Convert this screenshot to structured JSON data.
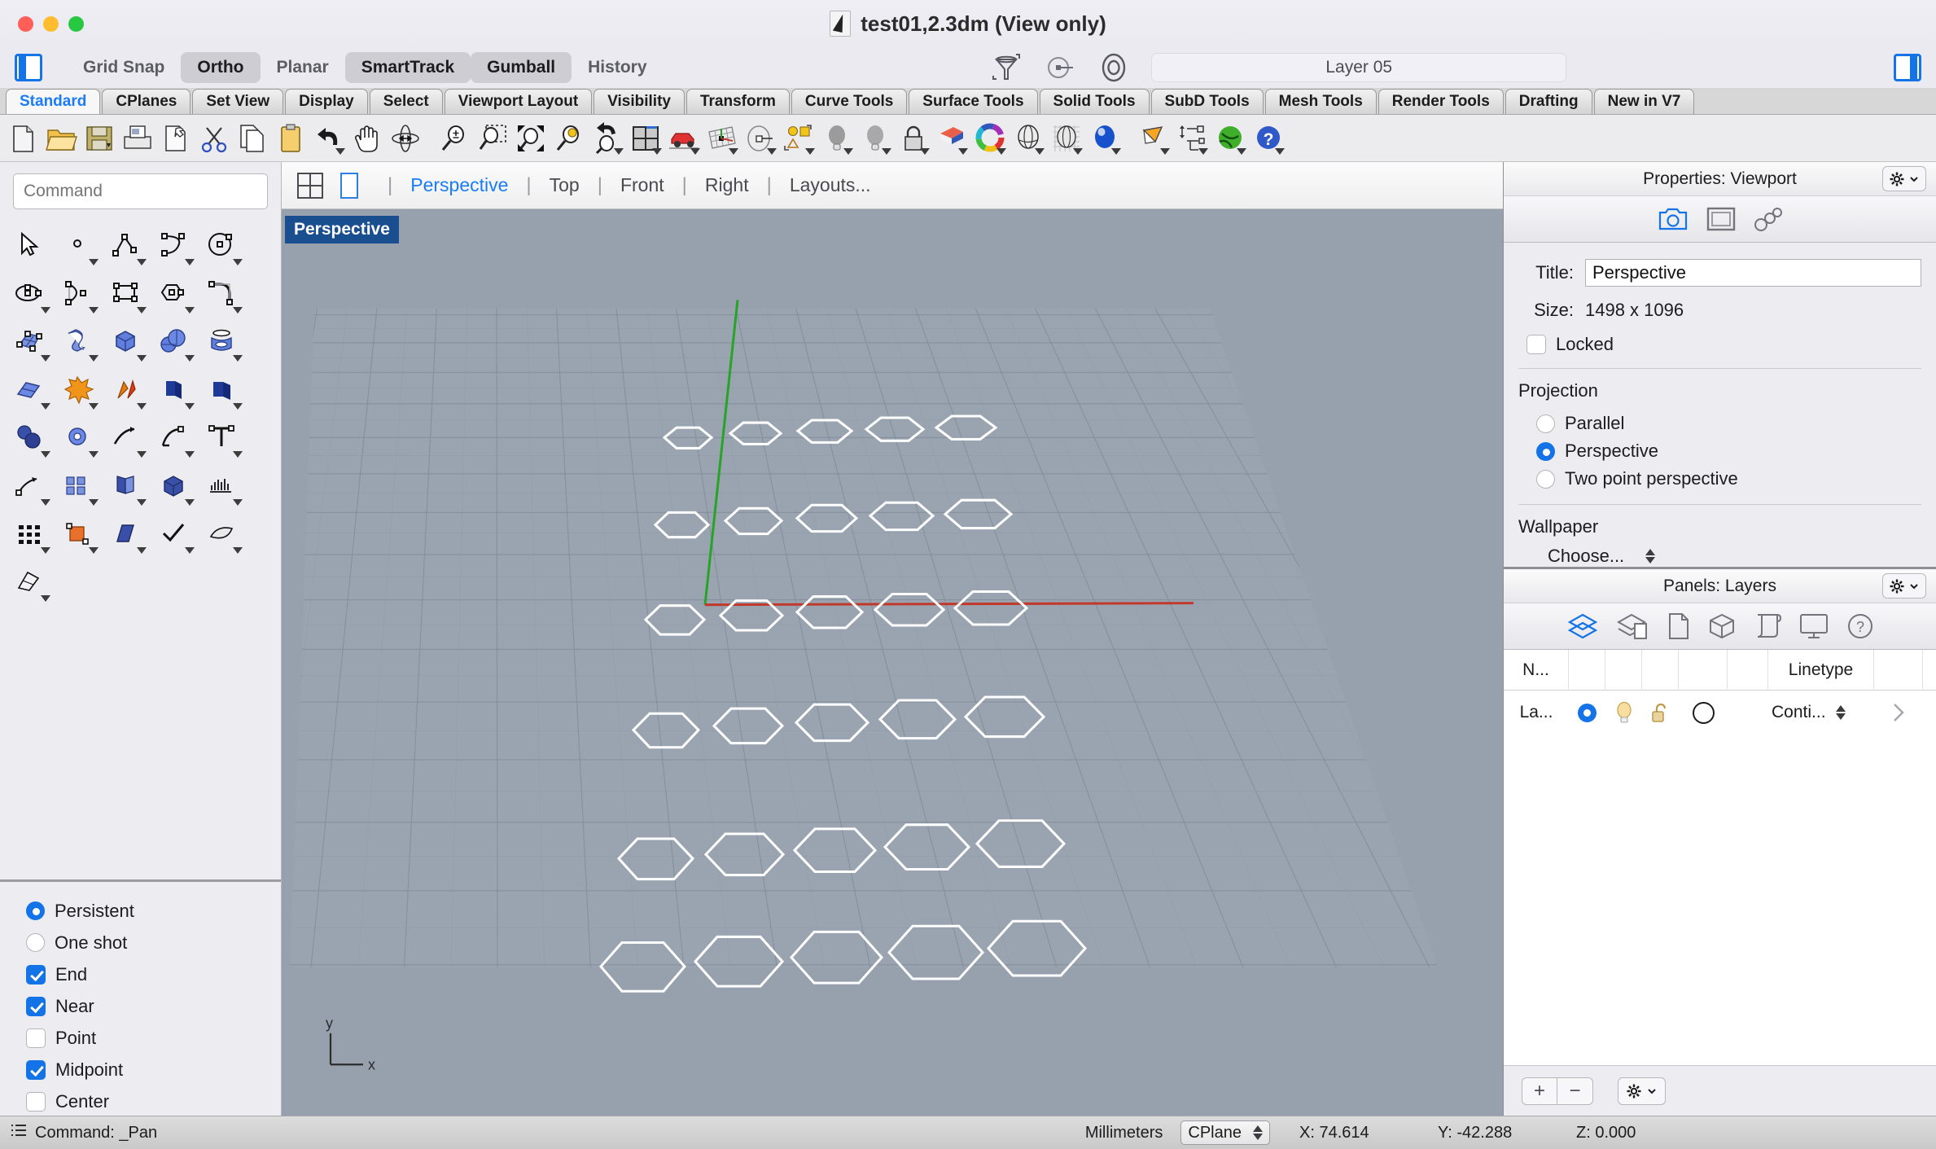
{
  "window": {
    "title": "test01,2.3dm (View only)",
    "doc_icon": "rhino-document-icon"
  },
  "toggles": [
    {
      "label": "Grid Snap",
      "on": false
    },
    {
      "label": "Ortho",
      "on": true
    },
    {
      "label": "Planar",
      "on": false
    },
    {
      "label": "SmartTrack",
      "on": true
    },
    {
      "label": "Gumball",
      "on": true
    },
    {
      "label": "History",
      "on": false
    }
  ],
  "header": {
    "filter_icon": "filter-funnel-icon",
    "target_icon": "set-layer-target-icon",
    "circle_icon": "layer-circle-icon",
    "layer_combo": "Layer 05"
  },
  "tabs": [
    "Standard",
    "CPlanes",
    "Set View",
    "Display",
    "Select",
    "Viewport Layout",
    "Visibility",
    "Transform",
    "Curve Tools",
    "Surface Tools",
    "Solid Tools",
    "SubD Tools",
    "Mesh Tools",
    "Render Tools",
    "Drafting",
    "New in V7"
  ],
  "active_tab": "Standard",
  "toolbar_icons": [
    "new-file-icon",
    "open-folder-icon",
    "save-icon",
    "print-icon",
    "copy-to-clipboard-icon",
    "cut-scissors-icon",
    "copy-icon",
    "paste-icon",
    "undo-icon",
    "pan-hand-icon",
    "rotate-view-icon",
    "zoom-icon",
    "zoom-window-icon",
    "zoom-extents-icon",
    "zoom-selected-icon",
    "undo-view-change-icon",
    "four-viewport-icon",
    "walkthrough-car-icon",
    "set-cplane-icon",
    "named-view-icon",
    "layer-shapes-icon",
    "light-bulb-icon",
    "light-bulb-gray-icon",
    "lock-icon",
    "render-color-icon",
    "color-wheel-icon",
    "shaded-sphere-icon",
    "ghosted-sphere-icon",
    "rendered-sphere-icon",
    "spotlight-icon",
    "dimension-icon",
    "render-globe-icon",
    "help-icon"
  ],
  "command": {
    "placeholder": "Command"
  },
  "palette": [
    [
      "select-arrow-icon",
      "point-icon",
      "polyline-icon",
      "curve-icon",
      "circle-icon"
    ],
    [
      "ellipse-icon",
      "arc-icon",
      "rectangle-icon",
      "polygon-icon",
      "fillet-curve-icon"
    ],
    [
      "surface-from-points-icon",
      "sweep-surface-icon",
      "box-icon",
      "sphere-boolean-icon",
      "revolve-icon"
    ],
    [
      "surface-edit-icon",
      "explode-icon",
      "split-icon",
      "offset-surface-icon",
      "cap-planar-icon"
    ],
    [
      "solid-boolean-icon",
      "join-icon",
      "trim-icon",
      "blend-curve-icon",
      "text-icon"
    ],
    [
      "dimension-linear-icon",
      "array-icon",
      "mirror-icon",
      "move-icon",
      "gradient-icon"
    ],
    [
      "grid-array-icon",
      "scale-icon",
      "shear-icon",
      "check-icon",
      "patch-icon"
    ],
    [
      "render-mesh-icon"
    ]
  ],
  "osnap": {
    "mode_options": [
      {
        "label": "Persistent",
        "selected": true
      },
      {
        "label": "One shot",
        "selected": false
      }
    ],
    "snaps": [
      {
        "label": "End",
        "checked": true
      },
      {
        "label": "Near",
        "checked": true
      },
      {
        "label": "Point",
        "checked": false
      },
      {
        "label": "Midpoint",
        "checked": true
      },
      {
        "label": "Center",
        "checked": false
      }
    ]
  },
  "viewport_bar": {
    "four_view_icon": "four-view-layout-icon",
    "single_view_icon": "single-view-layout-icon",
    "tabs": [
      {
        "label": "Perspective",
        "active": true
      },
      {
        "label": "Top",
        "active": false
      },
      {
        "label": "Front",
        "active": false
      },
      {
        "label": "Right",
        "active": false
      }
    ],
    "layouts": "Layouts..."
  },
  "viewport": {
    "label": "Perspective",
    "background": "#97a1ad",
    "grid_color": "#7d8794",
    "x_axis_color": "#c0392b",
    "y_axis_color": "#27a327",
    "object_color": "#ffffff",
    "axis_gizmo": {
      "x": "x",
      "y": "y"
    },
    "hexagon_rows": 6,
    "hexagon_cols": 5
  },
  "properties": {
    "panel_title": "Properties: Viewport",
    "gear_icon": "gear-icon",
    "icons": [
      "camera-icon",
      "viewport-frame-icon",
      "linked-objects-icon"
    ],
    "title_label": "Title:",
    "title_value": "Perspective",
    "size_label": "Size:",
    "size_value": "1498 x 1096",
    "locked_label": "Locked",
    "locked_checked": false,
    "projection_label": "Projection",
    "projection_options": [
      {
        "label": "Parallel",
        "selected": false
      },
      {
        "label": "Perspective",
        "selected": true
      },
      {
        "label": "Two point perspective",
        "selected": false
      }
    ],
    "wallpaper_label": "Wallpaper",
    "wallpaper_choose": "Choose..."
  },
  "layers_panel": {
    "panel_title": "Panels: Layers",
    "gear_icon": "gear-icon",
    "icons": [
      "layers-icon",
      "layers-material-icon",
      "page-icon",
      "cube-icon",
      "scroll-icon",
      "display-icon",
      "help-icon"
    ],
    "columns": [
      "N...",
      "",
      "",
      "",
      "",
      "",
      "Linetype",
      ""
    ],
    "rows": [
      {
        "name": "La...",
        "current_icon": "current-layer-dot",
        "visible_icon": "light-bulb-icon",
        "lock_icon": "unlocked-padlock-icon",
        "color_icon": "layer-color-swatch",
        "linetype": "Conti...",
        "expand_icon": "chevron-right-icon"
      }
    ],
    "footer": {
      "add_label": "+",
      "remove_label": "−",
      "gear_icon": "gear-icon"
    }
  },
  "statusbar": {
    "menu_icon": "list-menu-icon",
    "command_text": "Command: _Pan",
    "units": "Millimeters",
    "cplane_select": "CPlane",
    "x_label": "X:",
    "x_value": "74.614",
    "y_label": "Y:",
    "y_value": "-42.288",
    "z_label": "Z:",
    "z_value": "0.000"
  }
}
